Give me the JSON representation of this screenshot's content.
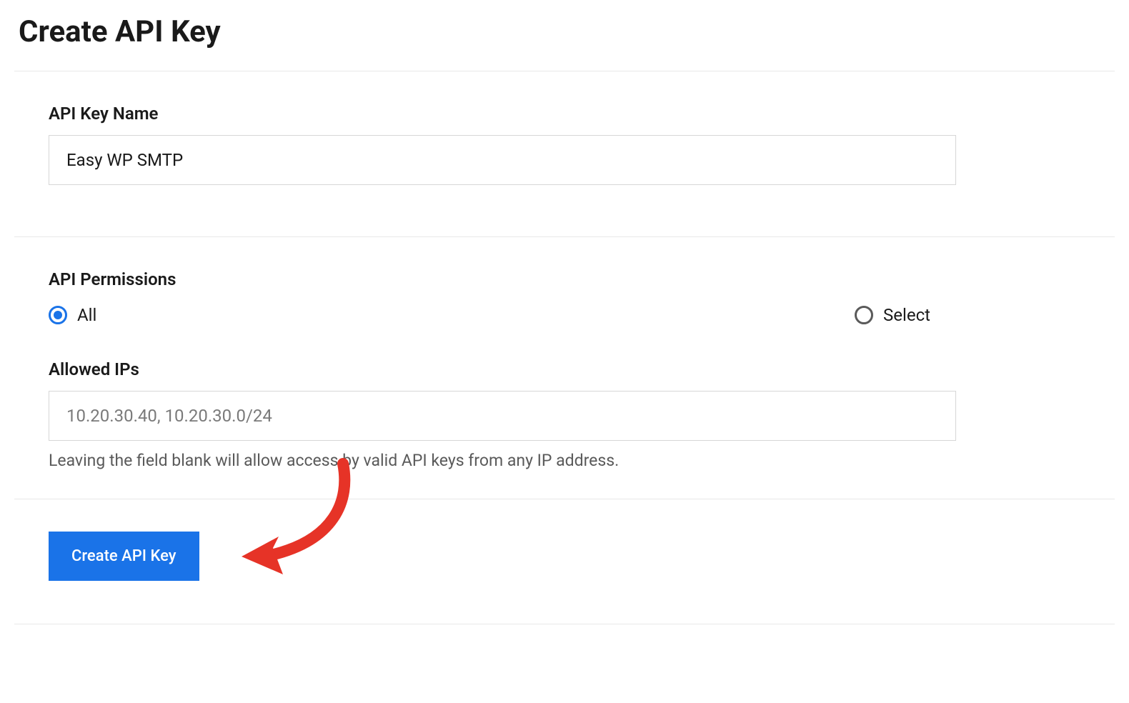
{
  "page": {
    "title": "Create API Key"
  },
  "form": {
    "api_key_name": {
      "label": "API Key Name",
      "value": "Easy WP SMTP"
    },
    "api_permissions": {
      "label": "API Permissions",
      "options": {
        "all": "All",
        "select": "Select"
      },
      "selected": "all"
    },
    "allowed_ips": {
      "label": "Allowed IPs",
      "value": "",
      "placeholder": "10.20.30.40, 10.20.30.0/24",
      "help": "Leaving the field blank will allow access by valid API keys from any IP address."
    },
    "submit_label": "Create API Key"
  }
}
